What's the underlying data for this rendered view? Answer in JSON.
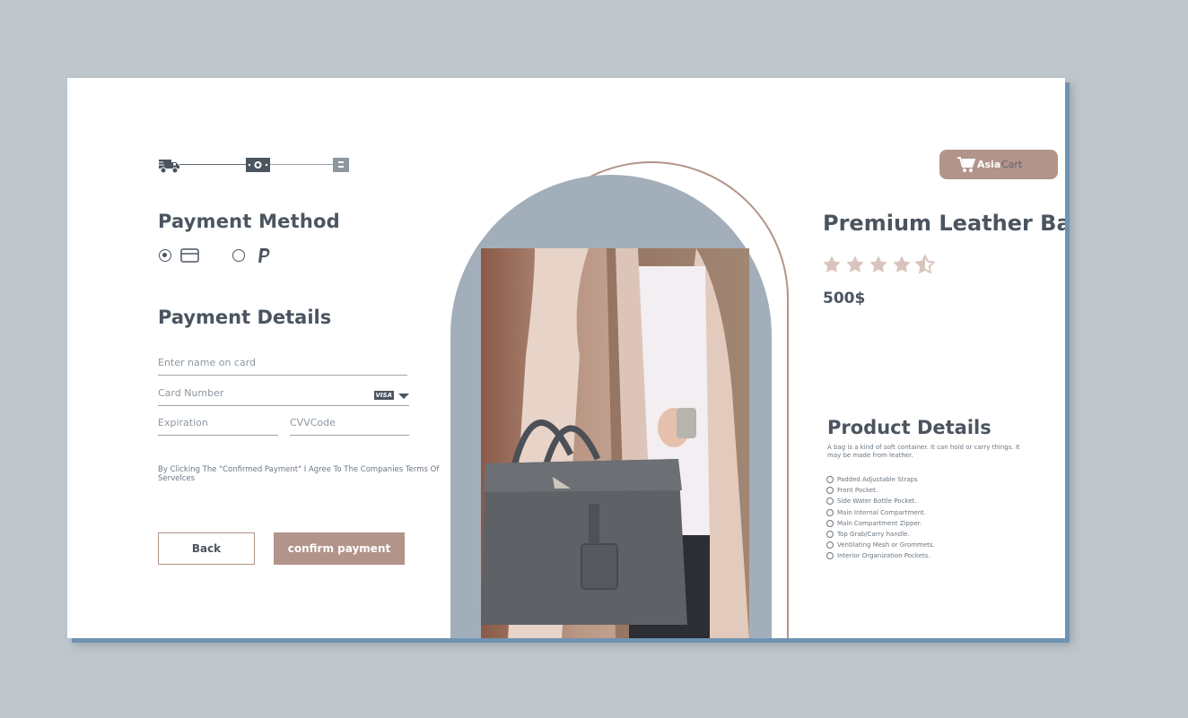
{
  "checkout": {
    "steps": [
      {
        "icon": "delivery-truck-icon"
      },
      {
        "icon": "cash-icon"
      },
      {
        "icon": "receipt-icon"
      }
    ],
    "payment_method": {
      "title": "Payment Method",
      "options": [
        {
          "icon": "credit-card-icon",
          "selected": true
        },
        {
          "icon": "paypal-icon",
          "selected": false
        }
      ]
    },
    "payment_details": {
      "title": "Payment Details",
      "name_placeholder": "Enter name on card",
      "card_placeholder": "Card Number",
      "card_brand": "VISA",
      "expiration_placeholder": "Expiration",
      "cvv_placeholder": "CVVCode"
    },
    "terms": "By Clicking The \"Confirmed Payment\" I Agree To The Companies Terms Of Servelces",
    "back_label": "Back",
    "confirm_label": "confirm payment"
  },
  "brand": {
    "first": "Asia",
    "second": "Cart",
    "icon": "shopping-cart-icon"
  },
  "product": {
    "title": "Premium Leather Bag",
    "rating": 4.5,
    "rating_max": 5,
    "price": "500$",
    "details_title": "Product Details",
    "description": "A bag is a kind of soft container. It can hold or carry things. It may be made from leather.",
    "features": [
      "Padded Adjustable Straps",
      "Front Pocket.",
      "Side Water Bottle Pocket.",
      "Main Internal Compartment.",
      "Main Compartment Zipper.",
      "Top Grab/Carry handle.",
      "Ventilating Mesh or Grommets.",
      "Interior Organization Pockets."
    ]
  },
  "colors": {
    "accent": "#b2948a",
    "slate": "#a2afbb",
    "text": "#4b5560",
    "background": "#bfc7cc"
  }
}
